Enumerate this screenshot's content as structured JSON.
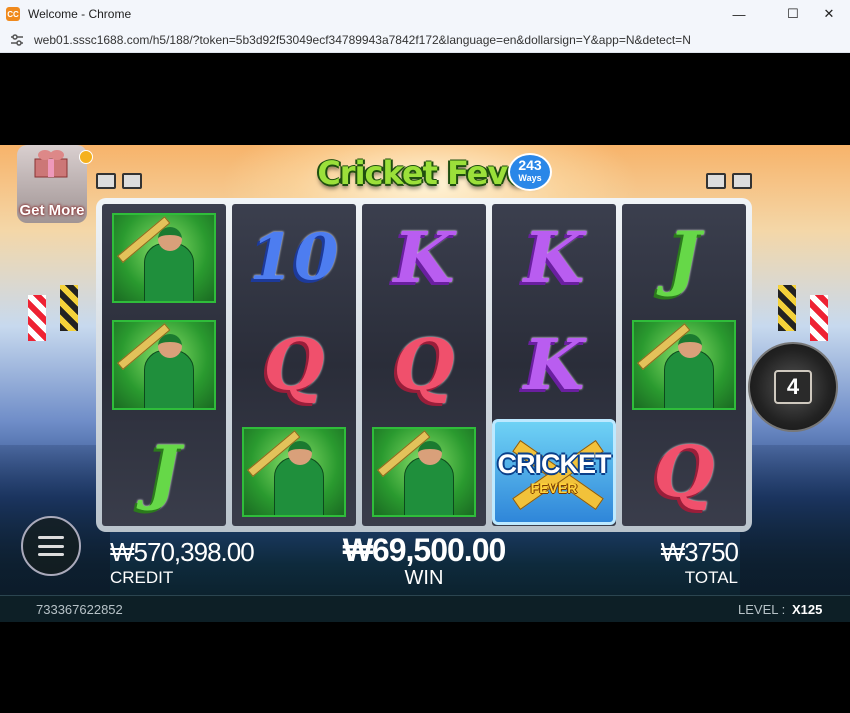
{
  "browser": {
    "window_title": "Welcome - Chrome",
    "app_icon_text": "CC",
    "url": "web01.sssc1688.com/h5/188/?token=5b3d92f53049ecf34789943a7842f172&language=en&dollarsign=Y&app=N&detect=N",
    "controls": {
      "minimize": "—",
      "maximize": "☐",
      "close": "✕"
    }
  },
  "game": {
    "logo": {
      "title": "Cricket Fever",
      "badge_number": "243",
      "badge_text": "Ways"
    },
    "get_more": {
      "label": "Get More"
    },
    "reels": [
      [
        "player",
        "player",
        "J"
      ],
      [
        "10",
        "Q",
        "player"
      ],
      [
        "K",
        "Q",
        "player"
      ],
      [
        "K",
        "K",
        "wild"
      ],
      [
        "J",
        "player",
        "Q"
      ]
    ],
    "wild_symbol": {
      "line1": "CRICKET",
      "line2": "FEVER"
    },
    "ways_counter": "4",
    "credit": {
      "value": "₩570,398.00",
      "label": "CREDIT"
    },
    "win": {
      "value": "₩69,500.00",
      "label": "WIN"
    },
    "total": {
      "value": "₩3750",
      "label": "TOTAL"
    },
    "footer": {
      "session_id": "733367622852",
      "level_label": "LEVEL :",
      "level_value": "X125"
    }
  }
}
